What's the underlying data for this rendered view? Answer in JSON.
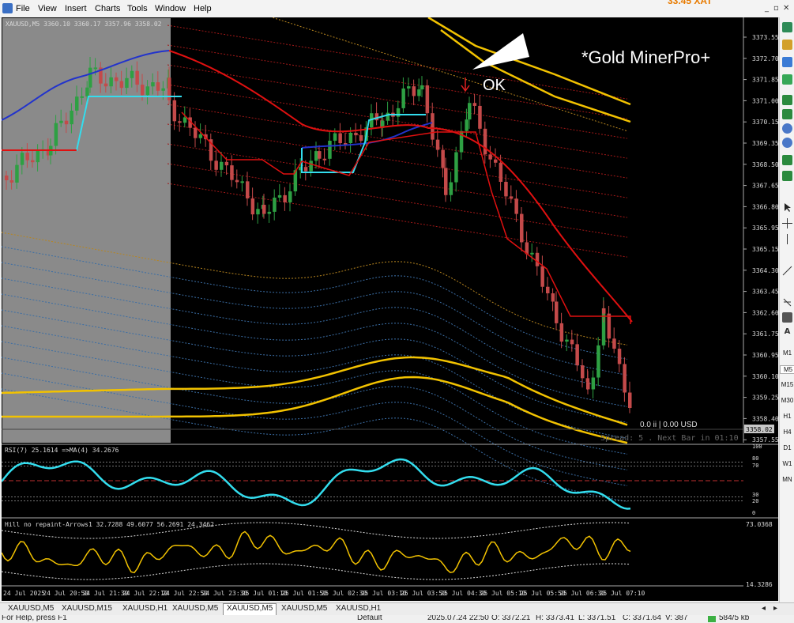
{
  "menu": {
    "items": [
      "File",
      "View",
      "Insert",
      "Charts",
      "Tools",
      "Window",
      "Help"
    ],
    "top_badge": "33.45 XAT"
  },
  "chart": {
    "header": "XAUUSD,M5  3360.10 3360.17 3357.96 3358.02",
    "watermark": "*Gold MinerPro+",
    "annotation_ok": "OK",
    "spread_text": "Spread: 5 . Next Bar in 01:10",
    "profit_text": "0.0 ii | 0.00 USD",
    "current_price": "3358.02",
    "price_axis": [
      "3373.55",
      "3372.70",
      "3371.85",
      "3371.00",
      "3370.15",
      "3369.35",
      "3368.50",
      "3367.65",
      "3366.80",
      "3365.95",
      "3365.15",
      "3364.30",
      "3363.45",
      "3362.60",
      "3361.75",
      "3360.95",
      "3360.10",
      "3359.25",
      "3358.40",
      "3357.55"
    ],
    "time_axis": [
      "24 Jul 2025",
      "24 Jul 20:50",
      "24 Jul 21:30",
      "24 Jul 22:10",
      "24 Jul 22:50",
      "24 Jul 23:30",
      "25 Jul 01:10",
      "25 Jul 01:50",
      "25 Jul 02:30",
      "25 Jul 03:10",
      "25 Jul 03:50",
      "25 Jul 04:30",
      "25 Jul 05:10",
      "25 Jul 05:50",
      "25 Jul 06:30",
      "25 Jul 07:10"
    ],
    "colors": {
      "bull": "#2ea043",
      "bear": "#c44a4a",
      "ma_blue": "#2233cc",
      "ma_red": "#e01010",
      "cyan": "#33ddee",
      "gold": "#f2c200",
      "grid_blue": "#3b6ea5"
    }
  },
  "rsi": {
    "label": "RSI(7) 25.1614  =>MA(4) 34.2676",
    "levels": [
      "100",
      "80",
      "70",
      "30",
      "20",
      "0"
    ]
  },
  "hill": {
    "label": "Hill no repaint-Arrows1 32.7288 49.6077 56.2691 24.3462",
    "max": "73.0368",
    "min": "14.3286"
  },
  "tabs": [
    "XAUUSD,M5",
    "XAUUSD,M15",
    "XAUUSD,H1",
    "XAUUSD,M5",
    "XAUUSD,M5",
    "XAUUSD,M5",
    "XAUUSD,H1"
  ],
  "active_tab_index": 4,
  "status": {
    "help": "For Help, press F1",
    "profile": "Default",
    "datetime": "2025.07.24 22:50",
    "open": "O: 3372.21",
    "high": "H: 3373.41",
    "low": "L: 3371.51",
    "close": "C: 3371.64",
    "volume": "V: 387",
    "traffic": "584/5 kb"
  },
  "right_toolbar": {
    "timeframes": [
      "M1",
      "M5",
      "M15",
      "M30",
      "H1",
      "H4",
      "D1",
      "W1",
      "MN"
    ]
  }
}
